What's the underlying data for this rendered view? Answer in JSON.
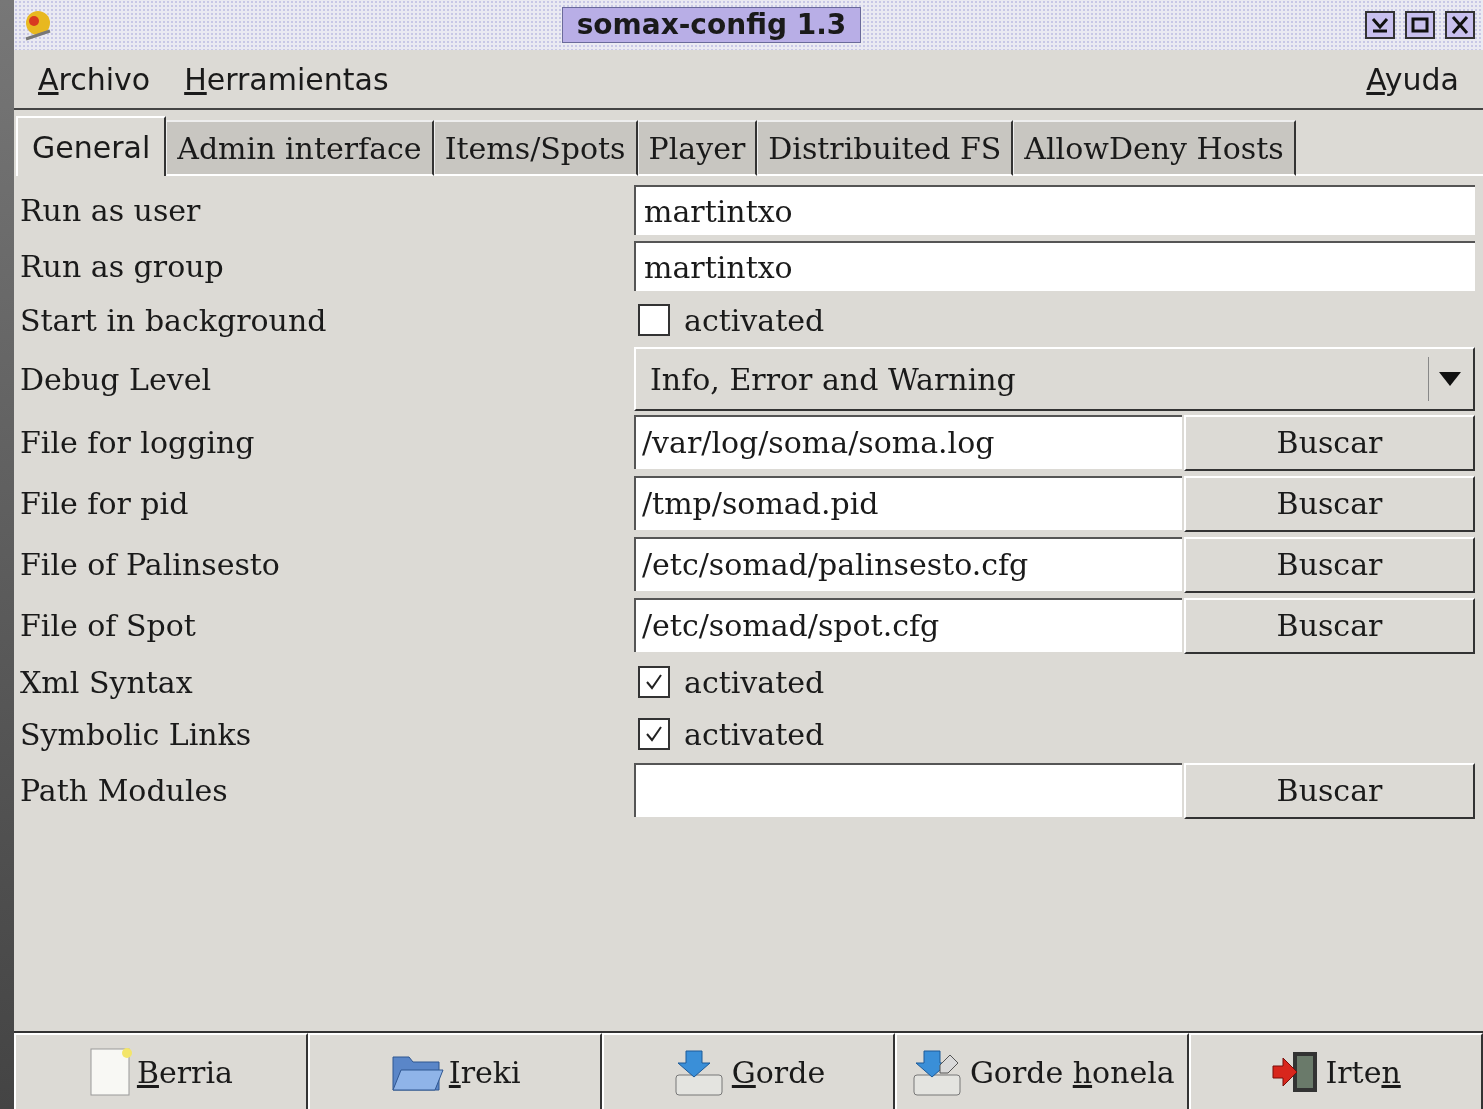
{
  "window": {
    "title": "somax-config 1.3"
  },
  "menu": {
    "left": [
      {
        "key": "A",
        "post": "rchivo"
      },
      {
        "key": "H",
        "post": "erramientas"
      }
    ],
    "right": [
      {
        "key": "A",
        "post": "yuda"
      }
    ]
  },
  "tabs": [
    {
      "label": "General",
      "selected": true
    },
    {
      "label": "Admin interface",
      "selected": false
    },
    {
      "label": "Items/Spots",
      "selected": false
    },
    {
      "label": "Player",
      "selected": false
    },
    {
      "label": "Distribuited FS",
      "selected": false
    },
    {
      "label": "AllowDeny Hosts",
      "selected": false
    }
  ],
  "rows": [
    {
      "kind": "text",
      "label": "Run as user",
      "value": "martintxo"
    },
    {
      "kind": "text",
      "label": "Run as group",
      "value": "martintxo"
    },
    {
      "kind": "checkbox",
      "label": "Start in background",
      "checked": false,
      "text": "activated"
    },
    {
      "kind": "select",
      "label": "Debug Level",
      "value": "Info, Error and Warning"
    },
    {
      "kind": "file",
      "label": "File for logging",
      "value": "/var/log/soma/soma.log",
      "button": "Buscar"
    },
    {
      "kind": "file",
      "label": "File for pid",
      "value": "/tmp/somad.pid",
      "button": "Buscar"
    },
    {
      "kind": "file",
      "label": "File of Palinsesto",
      "value": "/etc/somad/palinsesto.cfg",
      "button": "Buscar"
    },
    {
      "kind": "file",
      "label": "File of Spot",
      "value": "/etc/somad/spot.cfg",
      "button": "Buscar"
    },
    {
      "kind": "checkbox",
      "label": "Xml Syntax",
      "checked": true,
      "text": "activated"
    },
    {
      "kind": "checkbox",
      "label": "Symbolic Links",
      "checked": true,
      "text": "activated"
    },
    {
      "kind": "file",
      "label": "Path Modules",
      "button": "Buscar"
    }
  ],
  "toolbar": [
    {
      "kind": "new",
      "key": "B",
      "post": "erria"
    },
    {
      "kind": "open",
      "key": "I",
      "post": "reki"
    },
    {
      "kind": "save",
      "key": "G",
      "post": "orde"
    },
    {
      "kind": "saveas",
      "pre": "Gorde ",
      "key": "h",
      "post": "onela"
    },
    {
      "kind": "exit",
      "pre": "Irte",
      "key": "n"
    }
  ]
}
